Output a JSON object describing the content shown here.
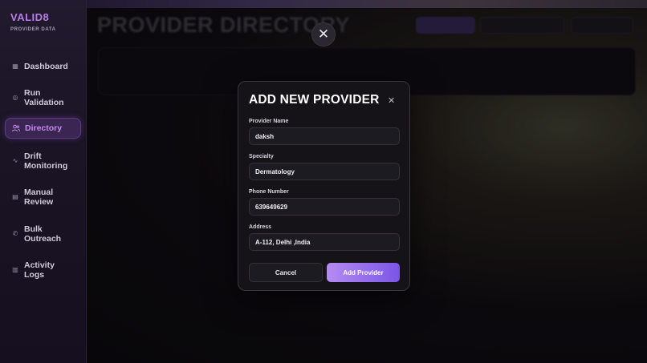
{
  "brand": {
    "name": "VALID8",
    "subtitle": "PROVIDER DATA"
  },
  "sidebar": {
    "items": [
      {
        "label": "Dashboard",
        "icon": "grid-icon"
      },
      {
        "label": "Run Validation",
        "icon": "target-icon"
      },
      {
        "label": "Directory",
        "icon": "users-icon",
        "active": true
      },
      {
        "label": "Drift Monitoring",
        "icon": "pulse-icon"
      },
      {
        "label": "Manual Review",
        "icon": "document-icon"
      },
      {
        "label": "Bulk Outreach",
        "icon": "phone-icon"
      },
      {
        "label": "Activity Logs",
        "icon": "clipboard-icon"
      }
    ]
  },
  "page": {
    "title": "PROVIDER DIRECTORY"
  },
  "modal": {
    "title": "ADD NEW PROVIDER",
    "fields": {
      "name": {
        "label": "Provider Name",
        "value": "daksh"
      },
      "specialty": {
        "label": "Specialty",
        "value": "Dermatology"
      },
      "phone": {
        "label": "Phone Number",
        "value": "639649629"
      },
      "address": {
        "label": "Address",
        "value": "A-112, Delhi ,India"
      }
    },
    "cancel_label": "Cancel",
    "submit_label": "Add Provider"
  },
  "colors": {
    "accent": "#b77ee6",
    "button_gradient_start": "#b58bf2",
    "button_gradient_end": "#7a55e8"
  }
}
